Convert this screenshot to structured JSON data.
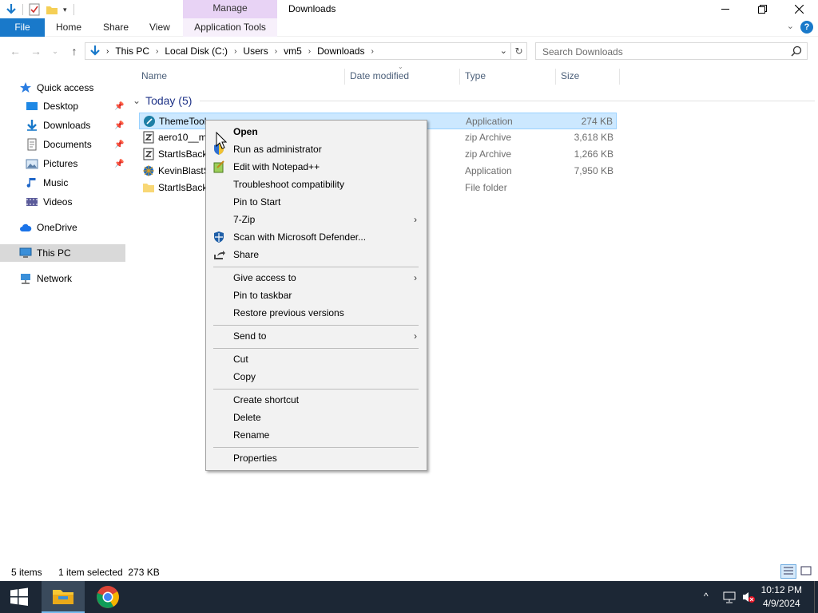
{
  "window": {
    "title": "Downloads",
    "context_tab_group": "Manage",
    "controls": {
      "minimize": "—",
      "maximize": "❐",
      "close": "✕"
    }
  },
  "ribbon": {
    "tabs": [
      "File",
      "Home",
      "Share",
      "View",
      "Application Tools"
    ],
    "help": "?",
    "collapse": "⌄"
  },
  "address": {
    "breadcrumbs": [
      "This PC",
      "Local Disk (C:)",
      "Users",
      "vm5",
      "Downloads"
    ],
    "search_placeholder": "Search Downloads"
  },
  "nav_pane": [
    {
      "label": "Quick access",
      "icon": "star-icon",
      "pinned": false
    },
    {
      "label": "Desktop",
      "icon": "desktop-folder-icon",
      "pinned": true
    },
    {
      "label": "Downloads",
      "icon": "download-arrow-icon",
      "pinned": true
    },
    {
      "label": "Documents",
      "icon": "documents-icon",
      "pinned": true
    },
    {
      "label": "Pictures",
      "icon": "pictures-icon",
      "pinned": true
    },
    {
      "label": "Music",
      "icon": "music-note-icon",
      "pinned": false
    },
    {
      "label": "Videos",
      "icon": "videos-icon",
      "pinned": false
    },
    {
      "label": "OneDrive",
      "icon": "cloud-icon",
      "pinned": false
    },
    {
      "label": "This PC",
      "icon": "computer-icon",
      "pinned": false
    },
    {
      "label": "Network",
      "icon": "network-icon",
      "pinned": false
    }
  ],
  "columns": [
    "Name",
    "Date modified",
    "Type",
    "Size"
  ],
  "group": {
    "label": "Today (5)"
  },
  "files": [
    {
      "name": "ThemeTool",
      "type": "Application",
      "size": "274 KB",
      "selected": true
    },
    {
      "name": "aero10__m",
      "type": "zip Archive",
      "size": "3,618 KB",
      "selected": false
    },
    {
      "name": "StartIsBack",
      "type": "zip Archive",
      "size": "1,266 KB",
      "selected": false
    },
    {
      "name": "KevinBlastS",
      "type": "Application",
      "size": "7,950 KB",
      "selected": false
    },
    {
      "name": "StartIsBack",
      "type": "File folder",
      "size": "",
      "selected": false
    }
  ],
  "context_menu": {
    "items": [
      {
        "label": "Open",
        "bold": true
      },
      {
        "label": "Run as administrator",
        "icon": "shield-icon"
      },
      {
        "label": "Edit with Notepad++",
        "icon": "notepadpp-icon"
      },
      {
        "label": "Troubleshoot compatibility"
      },
      {
        "label": "Pin to Start"
      },
      {
        "label": "7-Zip",
        "submenu": true
      },
      {
        "label": "Scan with Microsoft Defender...",
        "icon": "defender-icon"
      },
      {
        "label": "Share",
        "icon": "share-icon"
      },
      {
        "label": "Give access to",
        "submenu": true
      },
      {
        "label": "Pin to taskbar"
      },
      {
        "label": "Restore previous versions"
      },
      {
        "label": "Send to",
        "submenu": true
      },
      {
        "label": "Cut"
      },
      {
        "label": "Copy"
      },
      {
        "label": "Create shortcut"
      },
      {
        "label": "Delete"
      },
      {
        "label": "Rename"
      },
      {
        "label": "Properties"
      }
    ],
    "submenu_arrow": "›"
  },
  "status": {
    "count": "5 items",
    "selection": "1 item selected  273 KB"
  },
  "taskbar": {
    "time": "10:12 PM",
    "date": "4/9/2024"
  },
  "colors": {
    "accent": "#1979ca",
    "manage_tab": "#e8d3f5",
    "selection": "#cce8ff",
    "taskbar": "#1c2735"
  }
}
